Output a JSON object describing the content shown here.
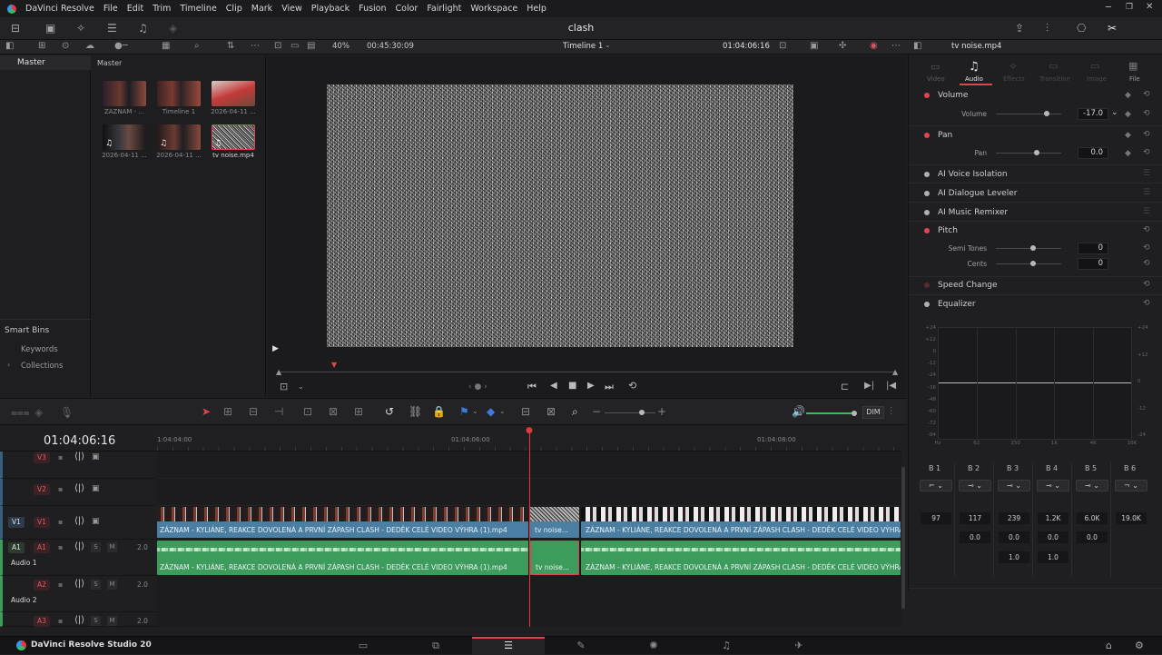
{
  "app": {
    "name": "DaVinci Resolve",
    "project_title": "clash",
    "footer_name": "DaVinci Resolve Studio 20"
  },
  "menu": [
    "File",
    "Edit",
    "Trim",
    "Timeline",
    "Clip",
    "Mark",
    "View",
    "Playback",
    "Fusion",
    "Color",
    "Fairlight",
    "Workspace",
    "Help"
  ],
  "viewer": {
    "zoom": "40%",
    "source_timecode": "00:45:30:09",
    "timeline_name": "Timeline 1",
    "record_timecode": "01:04:06:16"
  },
  "media_pool": {
    "bin_root": "Master",
    "bin_header": "Master",
    "smart_bins": "Smart Bins",
    "smart_items": [
      "Keywords",
      "Collections"
    ],
    "clips": [
      {
        "label": "ZÁZNAM - ..."
      },
      {
        "label": "Timeline 1"
      },
      {
        "label": "2026-04-11 ..."
      },
      {
        "label": "2026-04-11 ..."
      },
      {
        "label": "2026-04-11 ..."
      },
      {
        "label": "tv noise.mp4"
      }
    ]
  },
  "inspector": {
    "clip_name": "tv noise.mp4",
    "tabs": [
      "Video",
      "Audio",
      "Effects",
      "Transition",
      "Image",
      "File"
    ],
    "active_tab": "Audio",
    "volume": {
      "title": "Volume",
      "param": "Volume",
      "value": "-17.0",
      "level": 0.78
    },
    "pan": {
      "title": "Pan",
      "param": "Pan",
      "value": "0.0",
      "level": 0.62
    },
    "sections": [
      "AI Voice Isolation",
      "AI Dialogue Leveler",
      "AI Music Remixer"
    ],
    "pitch": {
      "title": "Pitch",
      "semi_label": "Semi Tones",
      "semi_value": "0",
      "cents_label": "Cents",
      "cents_value": "0"
    },
    "speed_change": "Speed Change",
    "equalizer": {
      "title": "Equalizer",
      "y_left": [
        "+24",
        "+12",
        "0",
        "-12",
        "-24",
        "-36",
        "-48",
        "-60",
        "-72",
        "-84"
      ],
      "y_right": [
        "+24",
        "+12",
        "0",
        "-12",
        "-24"
      ],
      "x_labels": [
        "Hz",
        "62",
        "250",
        "1K",
        "4K",
        "16K"
      ],
      "bands": [
        "B 1",
        "B 2",
        "B 3",
        "B 4",
        "B 5",
        "B 6"
      ],
      "freq": [
        "97",
        "117",
        "239",
        "1.2K",
        "6.0K",
        "19.0K"
      ],
      "gain": [
        "",
        "0.0",
        "0.0",
        "0.0",
        "0.0",
        ""
      ],
      "q": [
        "",
        "",
        "1.0",
        "1.0",
        "",
        ""
      ]
    }
  },
  "timeline": {
    "timecode": "01:04:06:16",
    "ruler": [
      "1:04:04:00",
      "01:04:06:00",
      "01:04:08:00"
    ],
    "tracks": {
      "v3": "V3",
      "v2": "V2",
      "v1_dest": "V1",
      "v1": "V1",
      "a1_dest": "A1",
      "a1": "A1",
      "a1_name": "Audio 1",
      "a1_level": "2.0",
      "a2": "A2",
      "a2_name": "Audio 2",
      "a2_level": "2.0",
      "a3": "A3",
      "a3_level": "2.0",
      "solo": "S",
      "mute": "M"
    },
    "clips": {
      "main_video": "ZÁZNAM - KYLIÁNE, REAKCE DOVOLENÁ A PRVNÍ ZÁPASH CLASH - DEDĚK CELÉ VIDEO VÝHRA (1).mp4",
      "noise_video": "tv noise...",
      "right_video": "ZÁZNAM - KYLIÁNE, REAKCE DOVOLENÁ A PRVNÍ ZÁPASH CLASH - DEDĚK CELÉ VIDEO VÝHRA (1)...",
      "main_audio": "ZÁZNAM - KYLIÁNE, REAKCE DOVOLENÁ A PRVNÍ ZÁPASH CLASH - DEDĚK CELÉ VIDEO VÝHRA (1).mp4",
      "noise_audio": "tv noise...",
      "right_audio": "ZÁZNAM - KYLIÁNE, REAKCE DOVOLENÁ A PRVNÍ ZÁPASH CLASH - DEDĚK CELÉ VIDEO VÝHRA (1)..."
    },
    "dim_label": "DIM"
  },
  "colors": {
    "accent_red": "#e0454f",
    "video_clip": "#4a7ea3",
    "audio_clip": "#3d9c5c",
    "playhead": "#e23a3a"
  }
}
